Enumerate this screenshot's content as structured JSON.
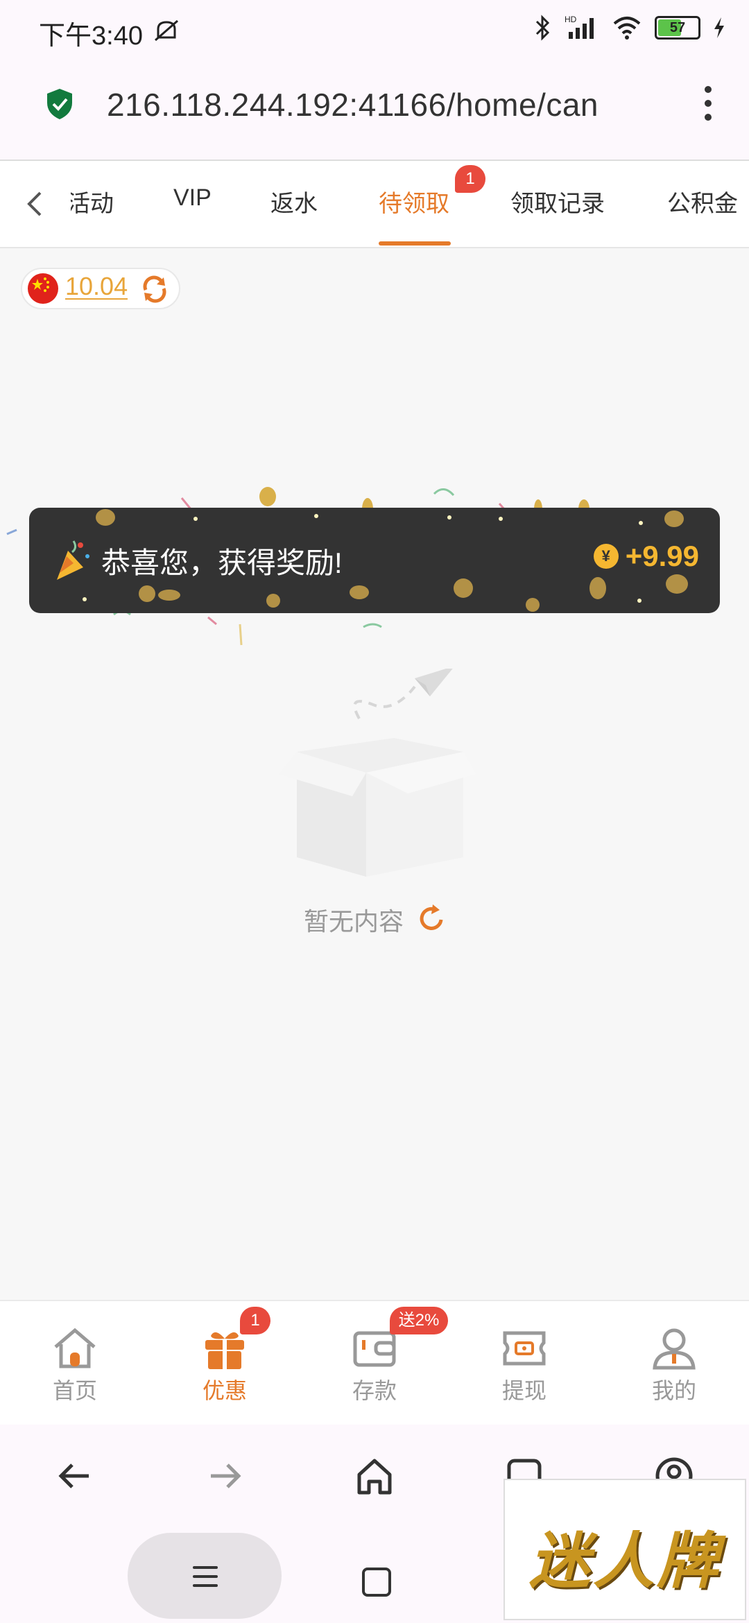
{
  "status_bar": {
    "time": "下午3:40",
    "hd_label": "HD",
    "battery": "57"
  },
  "browser": {
    "url": "216.118.244.192:41166/home/can"
  },
  "tabs": {
    "items": [
      {
        "label": "活动"
      },
      {
        "label": "VIP"
      },
      {
        "label": "返水"
      },
      {
        "label": "待领取"
      },
      {
        "label": "领取记录"
      },
      {
        "label": "公积金"
      }
    ],
    "active_index": 3,
    "badge": "1"
  },
  "balance": {
    "value": "10.04"
  },
  "toast": {
    "message": "恭喜您，获得奖励!",
    "coin_symbol": "¥",
    "amount": "+9.99"
  },
  "empty_state": {
    "text": "暂无内容"
  },
  "bottom_nav": {
    "items": [
      {
        "label": "首页",
        "icon": "home-icon"
      },
      {
        "label": "优惠",
        "icon": "gift-icon"
      },
      {
        "label": "存款",
        "icon": "wallet-icon"
      },
      {
        "label": "提现",
        "icon": "withdraw-icon"
      },
      {
        "label": "我的",
        "icon": "user-icon"
      }
    ],
    "active_index": 1,
    "promo_badge": "1",
    "deposit_badge": "送2%"
  },
  "watermark": {
    "text": "迷人牌"
  },
  "colors": {
    "accent": "#e57a2a",
    "badge": "#e84a3d",
    "gold": "#f5b731",
    "toast_bg": "#333333"
  }
}
